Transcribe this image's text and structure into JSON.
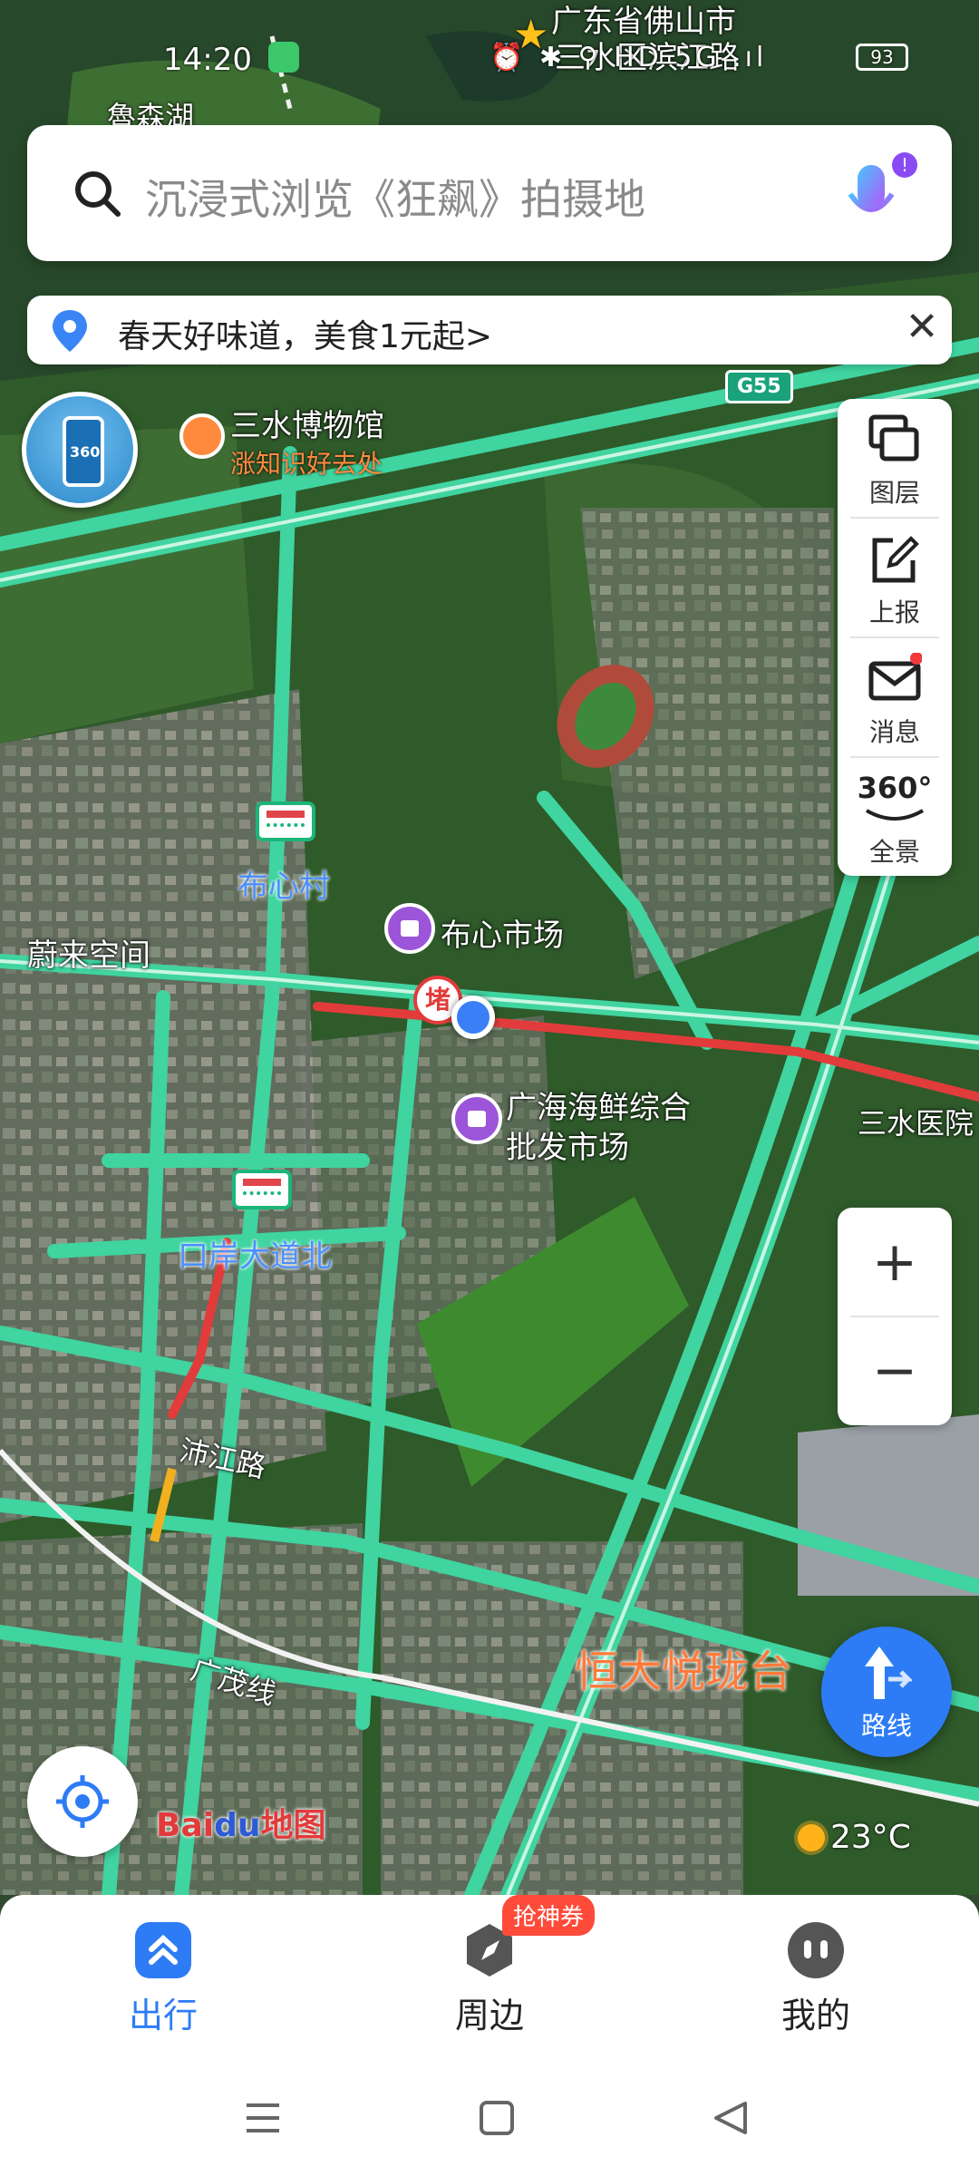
{
  "status_bar": {
    "time": "14:20",
    "icons": "⏰ ✱ ⚲ HD 5G .ıl",
    "battery": "93"
  },
  "search": {
    "placeholder": "沉浸式浏览《狂飙》拍摄地"
  },
  "promo": {
    "text": "春天好味道，美食1元起>",
    "close": "✕"
  },
  "map_labels": {
    "top_place": "广东省佛山市",
    "top_place2": "三水区滨江路",
    "lake": "魯森湖",
    "museum": "三水博物馆",
    "museum_sub": "涨知识好去处",
    "village": "布心村",
    "market": "布心市场",
    "jam": "堵",
    "left_place": "蔚来空间",
    "seafood_line1": "广海海鲜综合",
    "seafood_line2": "批发市场",
    "hospital": "三水医院",
    "port": "口岸大道北",
    "road_jiang": "沛江路",
    "road_guangmao": "广茂线",
    "estate": "恒大悦珑台",
    "highway": "G55"
  },
  "tools": {
    "layers": "图层",
    "report": "上报",
    "messages": "消息",
    "panorama": "全景",
    "panorama_icon_text": "360°"
  },
  "zoom": {
    "plus": "+",
    "minus": "−"
  },
  "route": {
    "label": "路线"
  },
  "logo": {
    "bai": "Bai",
    "du": "du",
    "map": "地图"
  },
  "weather": {
    "temp": "23°C"
  },
  "street_view": {
    "text": "360"
  },
  "bottom_nav": {
    "travel": "出行",
    "nearby": "周边",
    "mine": "我的",
    "badge": "抢神券"
  },
  "colors": {
    "accent": "#2d7cf6",
    "road": "#3fd4a0",
    "jam": "#e23b3b"
  }
}
